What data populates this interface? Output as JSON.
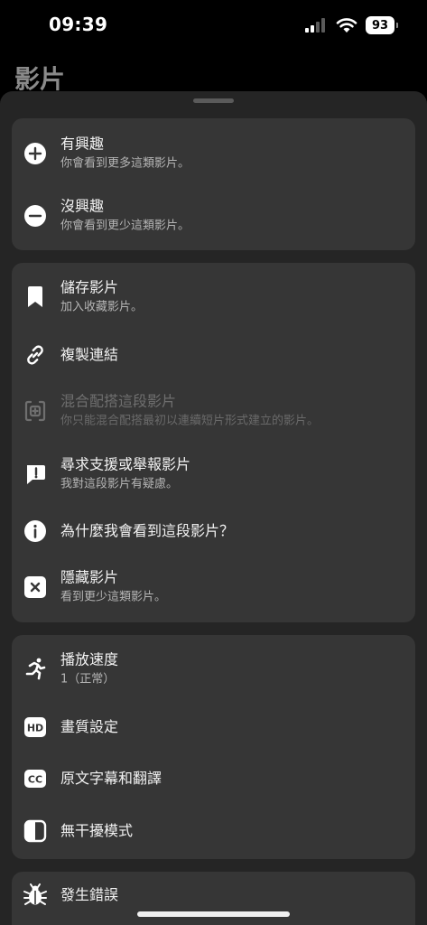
{
  "status_bar": {
    "time": "09:39",
    "battery": "93"
  },
  "page": {
    "title": "影片"
  },
  "sheet": {
    "group1": [
      {
        "label": "有興趣",
        "sub": "你會看到更多這類影片。",
        "icon": "plus-circle-icon"
      },
      {
        "label": "沒興趣",
        "sub": "你會看到更少這類影片。",
        "icon": "minus-circle-icon"
      }
    ],
    "group2": [
      {
        "label": "儲存影片",
        "sub": "加入收藏影片。",
        "icon": "bookmark-icon"
      },
      {
        "label": "複製連結",
        "icon": "link-icon"
      },
      {
        "label": "混合配搭這段影片",
        "sub": "你只能混合配搭最初以連續短片形式建立的影片。",
        "icon": "remix-icon",
        "disabled": true
      },
      {
        "label": "尋求支援或舉報影片",
        "sub": "我對這段影片有疑慮。",
        "icon": "report-icon"
      },
      {
        "label": "為什麼我會看到這段影片？",
        "icon": "info-icon"
      },
      {
        "label": "隱藏影片",
        "sub": "看到更少這類影片。",
        "icon": "hide-x-icon"
      }
    ],
    "group3": [
      {
        "label": "播放速度",
        "sub": "1（正常）",
        "icon": "running-icon"
      },
      {
        "label": "畫質設定",
        "icon": "hd-icon"
      },
      {
        "label": "原文字幕和翻譯",
        "icon": "cc-icon"
      },
      {
        "label": "無干擾模式",
        "icon": "contrast-icon"
      }
    ],
    "group4": [
      {
        "label": "發生錯誤",
        "icon": "bug-icon"
      }
    ]
  },
  "colors": {
    "sheet_bg": "#252525",
    "group_bg": "#363636",
    "text_primary": "#f2f2f2",
    "text_secondary": "#b5b5b5"
  }
}
